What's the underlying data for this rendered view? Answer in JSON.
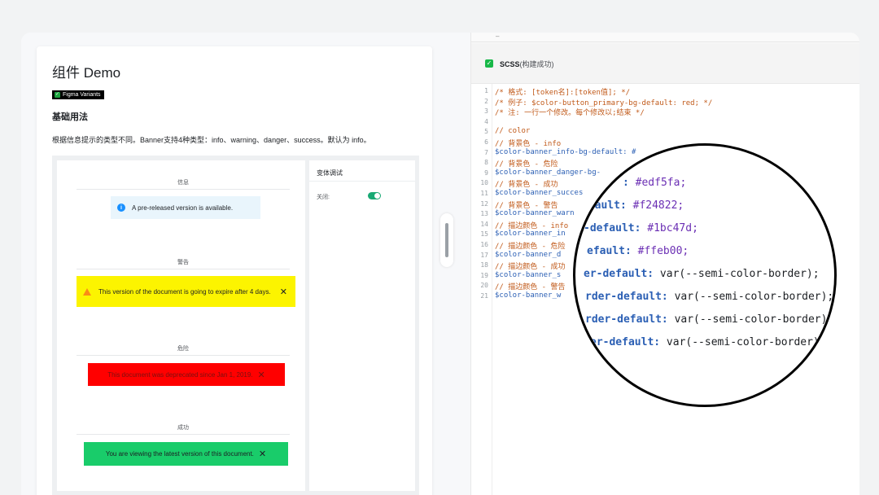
{
  "demo": {
    "title": "组件 Demo",
    "badge": "Figma Variants",
    "section_title": "基础用法",
    "description": "根据信息提示的类型不同。Banner支持4种类型：info、warning、danger、success。默认为 info。",
    "groups": {
      "info": "信息",
      "warning": "警告",
      "danger": "危险",
      "success": "成功"
    },
    "banners": {
      "info": "A pre-released version is available.",
      "warning": "This version of the document is going to expire after 4 days.",
      "danger": "This document was deprecated since Jan 1, 2019.",
      "success": "You are viewing the latest version of this document.",
      "close_glyph": "✕"
    },
    "variant_panel": {
      "title": "变体调试",
      "row_label": "关闭:",
      "toggle_on": true
    }
  },
  "build": {
    "label": "SCSS",
    "status": "(构建成功)"
  },
  "code": {
    "line_numbers": [
      "1",
      "2",
      "3",
      "4",
      "5",
      "6",
      "7",
      "8",
      "9",
      "10",
      "11",
      "12",
      "13",
      "14",
      "15",
      "16",
      "17",
      "18",
      "19",
      "20",
      "21"
    ],
    "lines": [
      {
        "text": "/* 格式: [token名]:[token值]; */",
        "kind": "comment"
      },
      {
        "text": "/* 例子: $color-button_primary-bg-default: red; */",
        "kind": "comment"
      },
      {
        "text": "/* 注: 一行一个修改。每个修改以;结束 */",
        "kind": "comment"
      },
      {
        "text": "",
        "kind": "comment"
      },
      {
        "text": "// color",
        "kind": "comment"
      },
      {
        "text": "// 背景色 - info",
        "kind": "comment"
      },
      {
        "text": "$color-banner_info-bg-default: #",
        "kind": "var"
      },
      {
        "text": "// 背景色 - 危险",
        "kind": "comment"
      },
      {
        "text": "$color-banner_danger-bg-",
        "kind": "var"
      },
      {
        "text": "// 背景色 - 成功",
        "kind": "comment"
      },
      {
        "text": "$color-banner_succes",
        "kind": "var"
      },
      {
        "text": "// 背景色 - 警告",
        "kind": "comment"
      },
      {
        "text": "$color-banner_warn",
        "kind": "var"
      },
      {
        "text": "// 描边颜色 - info",
        "kind": "comment"
      },
      {
        "text": "$color-banner_in",
        "kind": "var"
      },
      {
        "text": "// 描边颜色 - 危险",
        "kind": "comment"
      },
      {
        "text": "$color-banner_d",
        "kind": "var"
      },
      {
        "text": "// 描边颜色 - 成功",
        "kind": "comment"
      },
      {
        "text": "$color-banner_s",
        "kind": "var"
      },
      {
        "text": "// 描边颜色 - 警告",
        "kind": "comment"
      },
      {
        "text": "$color-banner_w",
        "kind": "var"
      }
    ]
  },
  "magnifier": {
    "lines": [
      {
        "key": ": ",
        "hex": "#edf5fa;",
        "tail": ""
      },
      {
        "key": "efault: ",
        "hex": "#f24822;",
        "tail": ""
      },
      {
        "key": "-default: ",
        "hex": "#1bc47d;",
        "tail": ""
      },
      {
        "key": "efault: ",
        "hex": "#ffeb00;",
        "tail": ""
      },
      {
        "key": "er-default: ",
        "hex": "",
        "tail": "var(--semi-color-border);"
      },
      {
        "key": "rder-default: ",
        "hex": "",
        "tail": "var(--semi-color-border);"
      },
      {
        "key": "rder-default: ",
        "hex": "",
        "tail": "var(--semi-color-border);"
      },
      {
        "key": "er-default: ",
        "hex": "",
        "tail": "var(--semi-color-border)"
      }
    ]
  },
  "colors": {
    "info_bg": "#e9f5fc",
    "warning_bg": "#fcf400",
    "danger_bg": "#ff0000",
    "success_bg": "#19cc6a",
    "toggle": "#19a974",
    "build_ok": "#18b848"
  },
  "icons": {
    "info": "info-circle-icon",
    "warning": "warning-triangle-icon",
    "close": "close-icon",
    "check": "checkbox-checked-icon"
  }
}
